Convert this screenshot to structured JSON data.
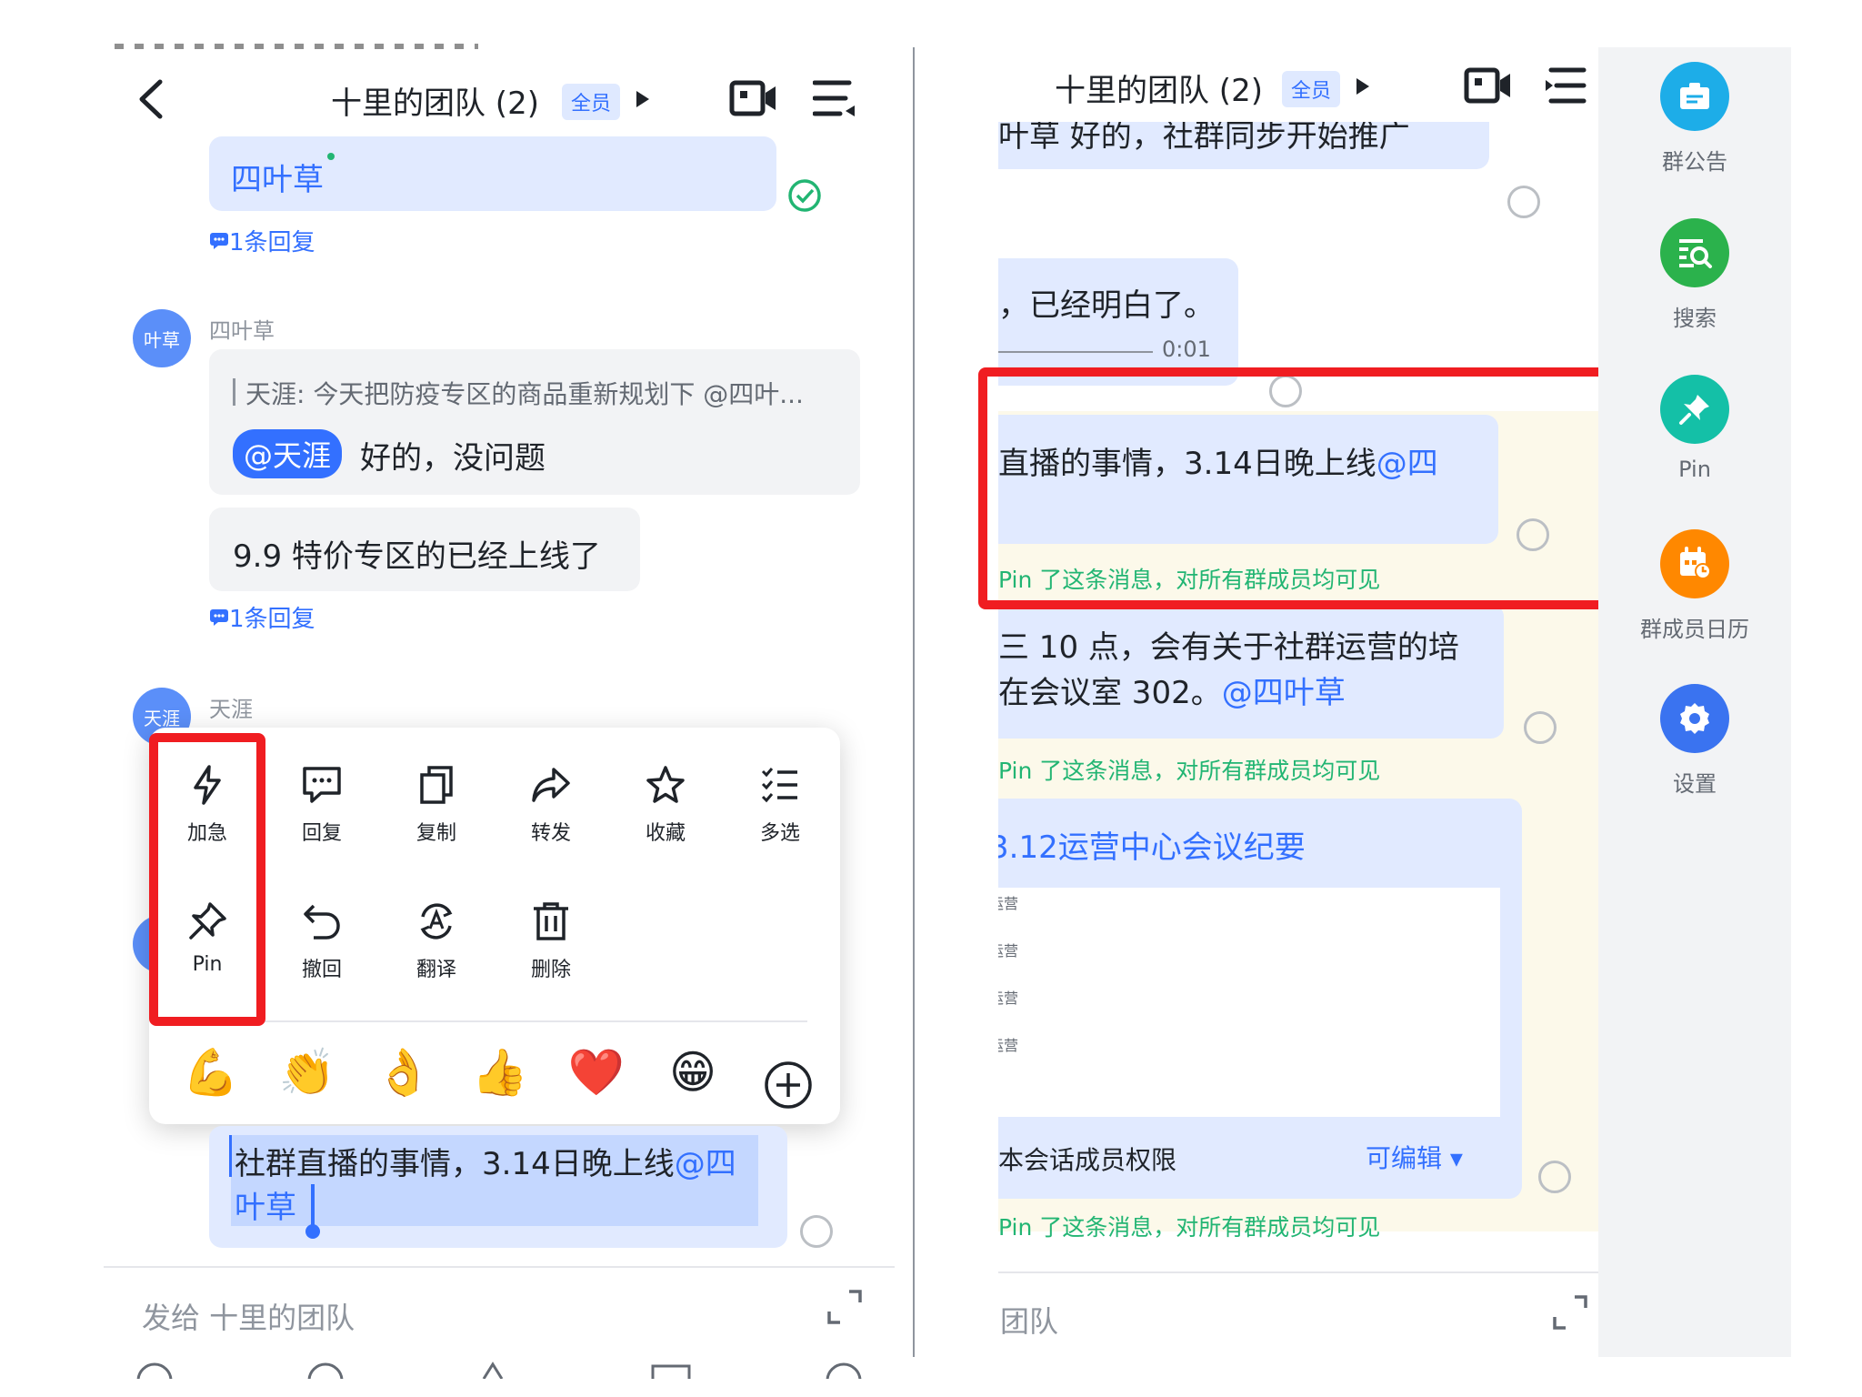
{
  "left": {
    "title": "十里的团队 (2)",
    "title_badge": "全员",
    "messages": {
      "first_bubble_tail": "四叶草",
      "reply_link_1": "1条回复",
      "sender_1": "四叶草",
      "avatar_1": "叶草",
      "quote_1": "天涯: 今天把防疫专区的商品重新规划下 @四叶...",
      "mention_1": "@天涯",
      "text_1": "好的，没问题",
      "text_2": "9.9 特价专区的已经上线了",
      "reply_link_2": "1条回复",
      "sender_2": "天涯",
      "avatar_2": "天涯",
      "selected_text_1": "社群直播的事情，3.14日晚上线",
      "selected_mention_1": "@四",
      "selected_mention_2": "叶草"
    },
    "menu": {
      "row1": [
        {
          "label": "加急",
          "icon": "lightning-icon"
        },
        {
          "label": "回复",
          "icon": "reply-bubble-icon"
        },
        {
          "label": "复制",
          "icon": "copy-icon"
        },
        {
          "label": "转发",
          "icon": "forward-icon"
        },
        {
          "label": "收藏",
          "icon": "star-icon"
        },
        {
          "label": "多选",
          "icon": "multi-select-icon"
        }
      ],
      "row2": [
        {
          "label": "Pin",
          "icon": "pin-icon"
        },
        {
          "label": "撤回",
          "icon": "undo-icon"
        },
        {
          "label": "翻译",
          "icon": "translate-icon"
        },
        {
          "label": "删除",
          "icon": "trash-icon"
        }
      ],
      "emojis": [
        "💪",
        "👏",
        "👌",
        "👍",
        "❤️",
        "😁"
      ]
    },
    "input_placeholder": "发给 十里的团队"
  },
  "right": {
    "title": "十里的团队 (2)",
    "title_badge": "全员",
    "top_cut_text": "叶草  好的，社群同步开始推广",
    "msg_understood": "，已经明白了。",
    "voice_time": "0:01",
    "pinned_msg_1": "直播的事情，3.14日晚上线",
    "pinned_mention_1": "@四",
    "pin_note_1": "Pin 了这条消息，对所有群成员均可见",
    "meeting_line_1": "三 10 点，会有关于社群运营的培",
    "meeting_line_2": "在会议室 302。",
    "meeting_mention": "@四叶草",
    "pin_note_2": "Pin 了这条消息，对所有群成员均可见",
    "doc_title": "3.12运营中心会议纪要",
    "doc_lines": [
      "运营",
      "运营",
      "运营",
      "运营"
    ],
    "permission_label": "本会话成员权限",
    "permission_value": "可编辑",
    "pin_note_3": "Pin 了这条消息，对所有群成员均可见",
    "input_placeholder": "团队"
  },
  "sidebar": [
    {
      "label": "群公告",
      "icon": "announcement-icon",
      "color": "#1dade8"
    },
    {
      "label": "搜索",
      "icon": "search-doc-icon",
      "color": "#2bb24c"
    },
    {
      "label": "Pin",
      "icon": "pin-icon",
      "color": "#14c0a7"
    },
    {
      "label": "群成员日历",
      "icon": "calendar-icon",
      "color": "#ff8800"
    },
    {
      "label": "设置",
      "icon": "gear-icon",
      "color": "#3a73f0"
    }
  ]
}
